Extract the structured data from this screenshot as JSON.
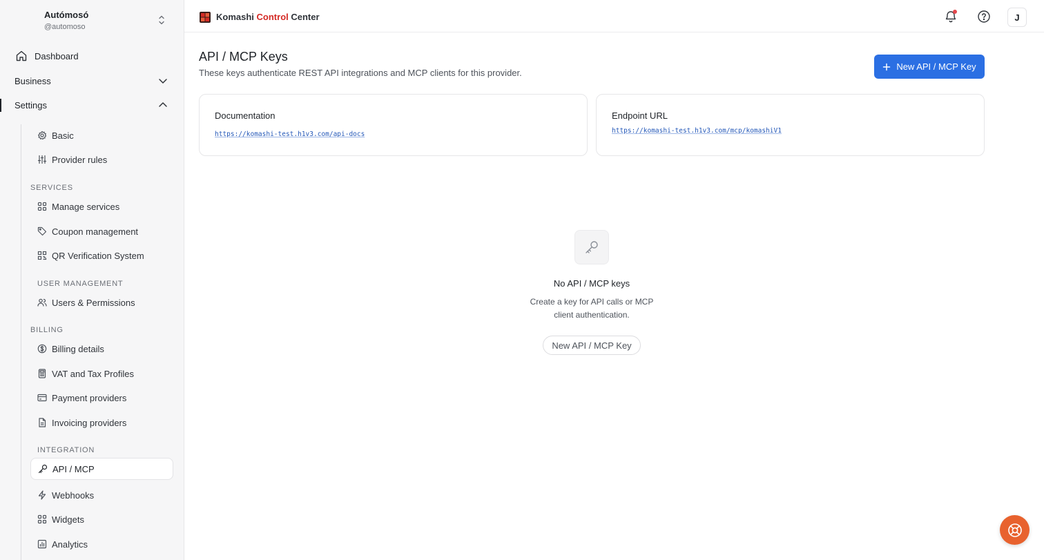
{
  "account": {
    "name": "Autómosó",
    "handle": "@automoso"
  },
  "nav": {
    "dashboard": "Dashboard",
    "business": "Business",
    "settings": "Settings"
  },
  "settings_menu": {
    "basic": "Basic",
    "provider_rules": "Provider rules",
    "services_label": "SERVICES",
    "manage_services": "Manage services",
    "coupon_management": "Coupon management",
    "qr_verification": "QR Verification System",
    "user_management_label": "USER MANAGEMENT",
    "users_permissions": "Users & Permissions",
    "billing_label": "BILLING",
    "billing_details": "Billing details",
    "vat_tax": "VAT and Tax Profiles",
    "payment_providers": "Payment providers",
    "invoicing_providers": "Invoicing providers",
    "integration_label": "INTEGRATION",
    "api_mcp": "API / MCP",
    "webhooks": "Webhooks",
    "widgets": "Widgets",
    "analytics": "Analytics"
  },
  "topbar": {
    "brand_part1": "Komashi",
    "brand_part2": "Control",
    "brand_part3": "Center",
    "avatar_initial": "J"
  },
  "main": {
    "title": "API / MCP Keys",
    "subtitle": "These keys authenticate REST API integrations and MCP clients for this provider.",
    "new_key_button": "New API / MCP Key",
    "doc_card": {
      "title": "Documentation",
      "url": "https://komashi-test.h1v3.com/api-docs"
    },
    "endpoint_card": {
      "title": "Endpoint URL",
      "url": "https://komashi-test.h1v3.com/mcp/komashiV1"
    },
    "empty": {
      "title": "No API / MCP keys",
      "description": "Create a key for API calls or MCP client authentication.",
      "button": "New API / MCP Key"
    }
  },
  "colors": {
    "primary": "#2b6fe3",
    "brand_red": "#d42a25",
    "help_fab": "#e8622e",
    "notification": "#e5484d"
  },
  "icons": {
    "dashboard": "home-icon",
    "business": "chevron-down-icon",
    "settings": "chevron-up-icon",
    "basic": "gear-icon",
    "provider_rules": "sliders-icon",
    "manage_services": "grid-icon",
    "coupon_management": "tag-icon",
    "qr_verification": "qr-icon",
    "users_permissions": "users-icon",
    "billing_details": "dollar-circle-icon",
    "vat_tax": "calculator-icon",
    "payment_providers": "credit-card-icon",
    "invoicing_providers": "document-icon",
    "api_mcp": "key-icon",
    "webhooks": "lightning-icon",
    "widgets": "grid-icon",
    "analytics": "chart-icon",
    "notifications": "bell-icon",
    "help": "help-circle-icon"
  }
}
